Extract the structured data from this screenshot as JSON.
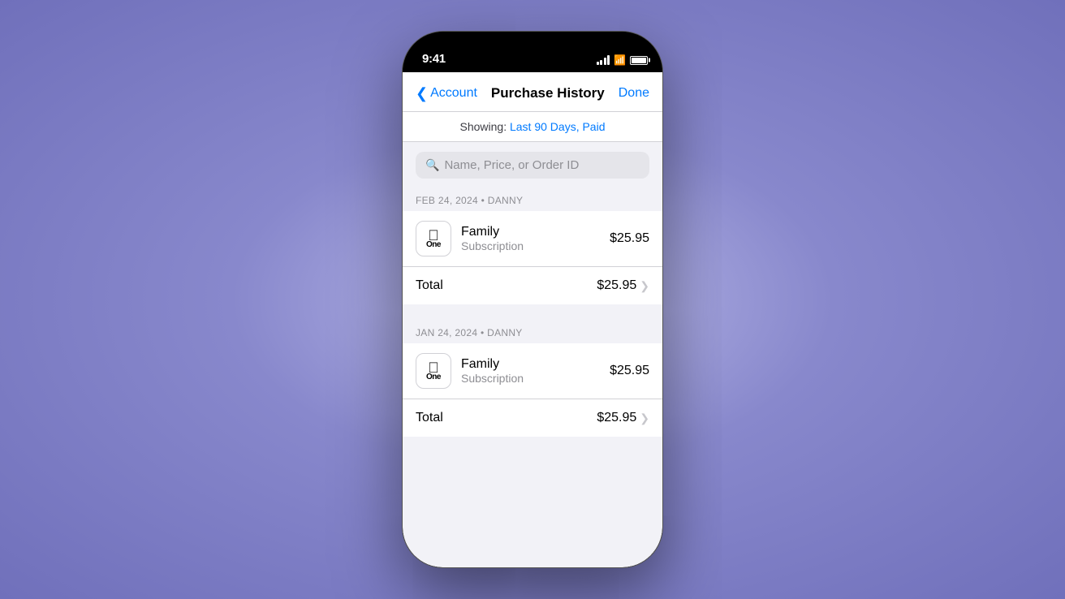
{
  "background": {
    "gradient": "radial-gradient(ellipse at center, #b8b8e8 0%, #8888cc 40%, #7070bb 100%)"
  },
  "status_bar": {
    "time": "9:41",
    "signal_bars": 4,
    "wifi": true,
    "battery": "full"
  },
  "nav": {
    "back_label": "Account",
    "title": "Purchase History",
    "done_label": "Done"
  },
  "filter": {
    "prefix": "Showing:",
    "value": "Last 90 Days, Paid"
  },
  "search": {
    "placeholder": "Name, Price, or Order ID"
  },
  "orders": [
    {
      "date": "FEB 24, 2024",
      "user": "Danny",
      "items": [
        {
          "app_name": "Family",
          "app_subtitle": "Subscription",
          "price": "$25.95"
        }
      ],
      "total_label": "Total",
      "total_price": "$25.95"
    },
    {
      "date": "JAN 24, 2024",
      "user": "Danny",
      "items": [
        {
          "app_name": "Family",
          "app_subtitle": "Subscription",
          "price": "$25.95"
        }
      ],
      "total_label": "Total",
      "total_price": "$25.95"
    }
  ]
}
